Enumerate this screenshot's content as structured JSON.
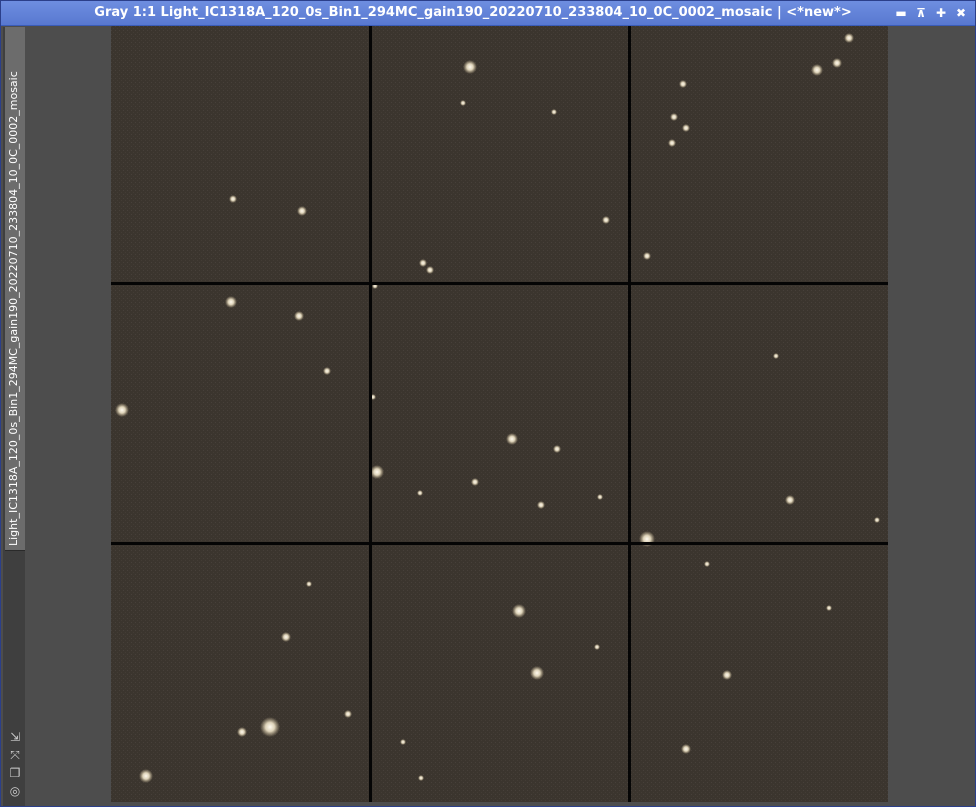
{
  "window": {
    "title": "Gray 1:1 Light_IC1318A_120_0s_Bin1_294MC_gain190_20220710_233804_10_0C_0002_mosaic | <*new*>",
    "buttons": [
      {
        "name": "minimize-button",
        "glyph": "▬"
      },
      {
        "name": "shade-button",
        "glyph": "⊼"
      },
      {
        "name": "maximize-button",
        "glyph": "✚"
      },
      {
        "name": "close-button",
        "glyph": "✖"
      }
    ]
  },
  "tab": {
    "label": "Light_IC1318A_120_0s_Bin1_294MC_gain190_20220710_233804_10_0C_0002_mosaic"
  },
  "side_icons": [
    {
      "name": "resize-icon",
      "glyph": "⇲"
    },
    {
      "name": "fit-icon",
      "glyph": "⤧"
    },
    {
      "name": "clone-icon",
      "glyph": "❐"
    },
    {
      "name": "mask-icon",
      "glyph": "◎"
    }
  ],
  "image": {
    "background_color": "#3b352e",
    "grid_color": "#050505",
    "star_color": "#f4ecd6",
    "grid": {
      "rows": 3,
      "cols": 3
    }
  }
}
